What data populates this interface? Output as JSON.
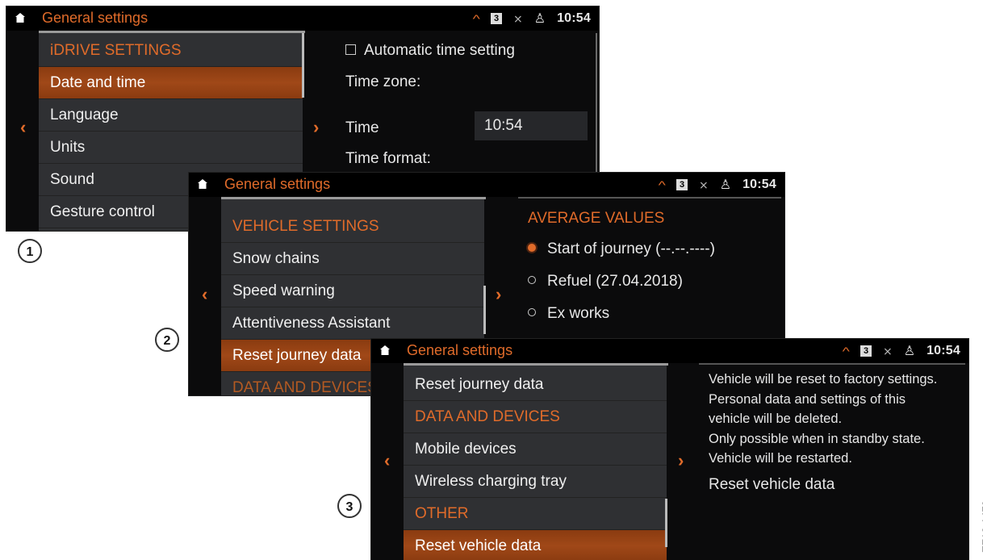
{
  "header_title": "General settings",
  "header_badge": "3",
  "header_time": "10:54",
  "screen1": {
    "section": "iDRIVE SETTINGS",
    "items": [
      "Date and time",
      "Language",
      "Units",
      "Sound",
      "Gesture control"
    ],
    "right": {
      "checkbox_label": "Automatic time setting",
      "time_zone_label": "Time zone:",
      "time_label": "Time",
      "time_value": "10:54",
      "time_format_label": "Time format:"
    }
  },
  "screen2": {
    "section": "VEHICLE SETTINGS",
    "items": [
      "Snow chains",
      "Speed warning",
      "Attentiveness Assistant",
      "Reset journey data"
    ],
    "next_section": "DATA AND DEVICES",
    "right": {
      "heading": "AVERAGE VALUES",
      "options": [
        "Start of journey (--.--.----)",
        "Refuel (27.04.2018)",
        "Ex works"
      ],
      "selected_index": 0
    }
  },
  "screen3": {
    "items_top": "Reset journey data",
    "section1": "DATA AND DEVICES",
    "items": [
      "Mobile devices",
      "Wireless charging tray"
    ],
    "section2": "OTHER",
    "selected": "Reset vehicle data",
    "right": {
      "lines": [
        "Vehicle will be reset to factory settings.",
        "Personal data and settings of this",
        "vehicle will be deleted.",
        "Only possible when in standby state.",
        "Vehicle will be restarted."
      ],
      "action": "Reset vehicle data"
    }
  },
  "callouts": [
    "1",
    "2",
    "3"
  ],
  "doc_id": "TE18-1479",
  "colors": {
    "accent": "#e06b2a",
    "menu_bg": "#2f3033",
    "screen_bg": "#0b0b0c"
  }
}
